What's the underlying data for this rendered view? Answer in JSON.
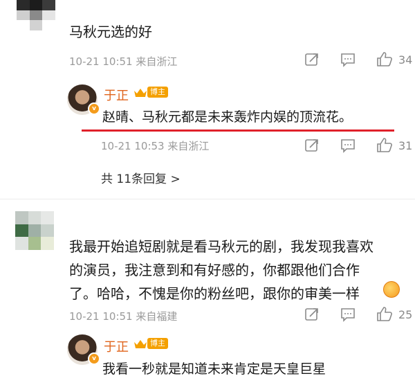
{
  "comments": [
    {
      "text": "马秋元选的好",
      "meta": "10-21 10:51 来自浙江",
      "likes": "34"
    },
    {
      "text_lines": [
        "我最开始追短剧就是看马秋元的剧，我发现我喜欢",
        "的演员，我注意到和有好感的，你都跟他们合作",
        "了。哈哈，不愧是你的粉丝吧，跟你的审美一样"
      ],
      "meta": "10-21 10:51 来自福建",
      "likes": "25"
    }
  ],
  "replies": [
    {
      "author": "于正",
      "badge": "博主",
      "text": "赵晴、马秋元都是未来轰炸内娱的顶流花。",
      "meta": "10-21 10:53 来自浙江",
      "likes": "31"
    },
    {
      "author": "于正",
      "badge": "博主",
      "text": "我看一秒就是知道未来肯定是天皇巨星"
    }
  ],
  "more_replies": "共 11条回复 >",
  "colors": {
    "underline": "#e0202a",
    "badge": "#f4a000",
    "meta": "#9a9a9a",
    "icon": "#8a8a8a"
  },
  "icons": [
    "share-icon",
    "comment-icon",
    "like-icon",
    "emoji-icon",
    "crown-icon"
  ]
}
